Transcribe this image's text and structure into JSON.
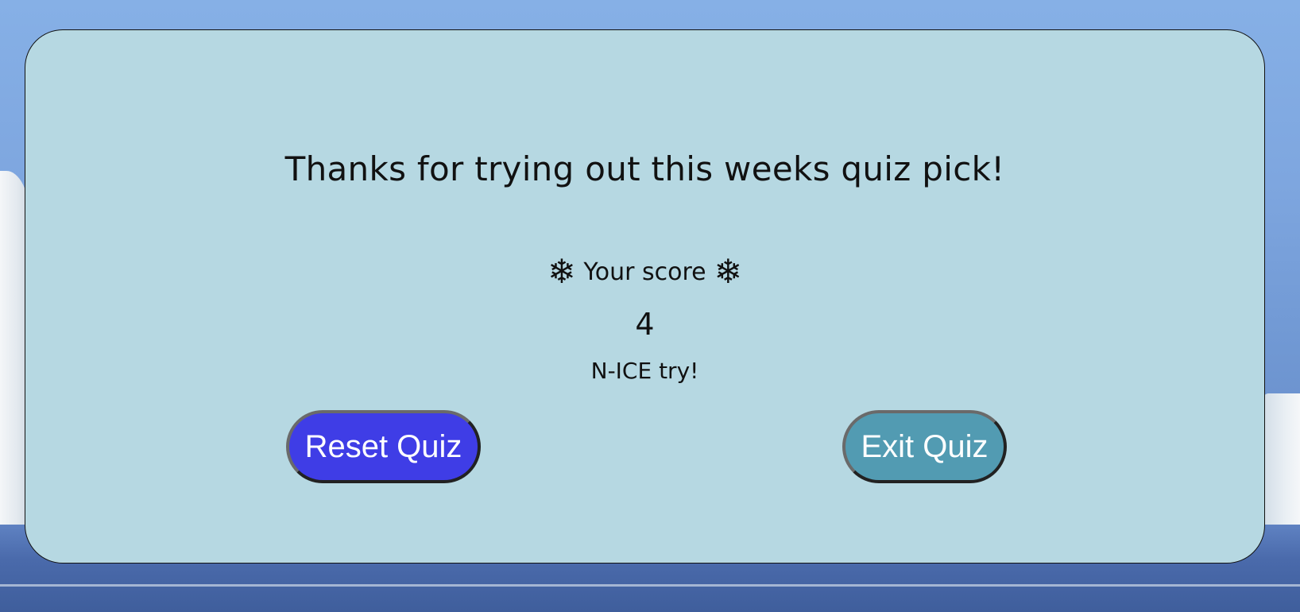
{
  "quiz_end": {
    "title": "Thanks for trying out this weeks quiz pick!",
    "score_label": "Your score",
    "score_icon": "❄",
    "score_value": "4",
    "feedback": "N-ICE try!",
    "buttons": {
      "reset_label": "Reset Quiz",
      "exit_label": "Exit Quiz"
    }
  },
  "colors": {
    "card_background": "#b6d8e2",
    "reset_button": "#3f3de6",
    "exit_button": "#529bb2",
    "button_text": "#ffffff"
  }
}
